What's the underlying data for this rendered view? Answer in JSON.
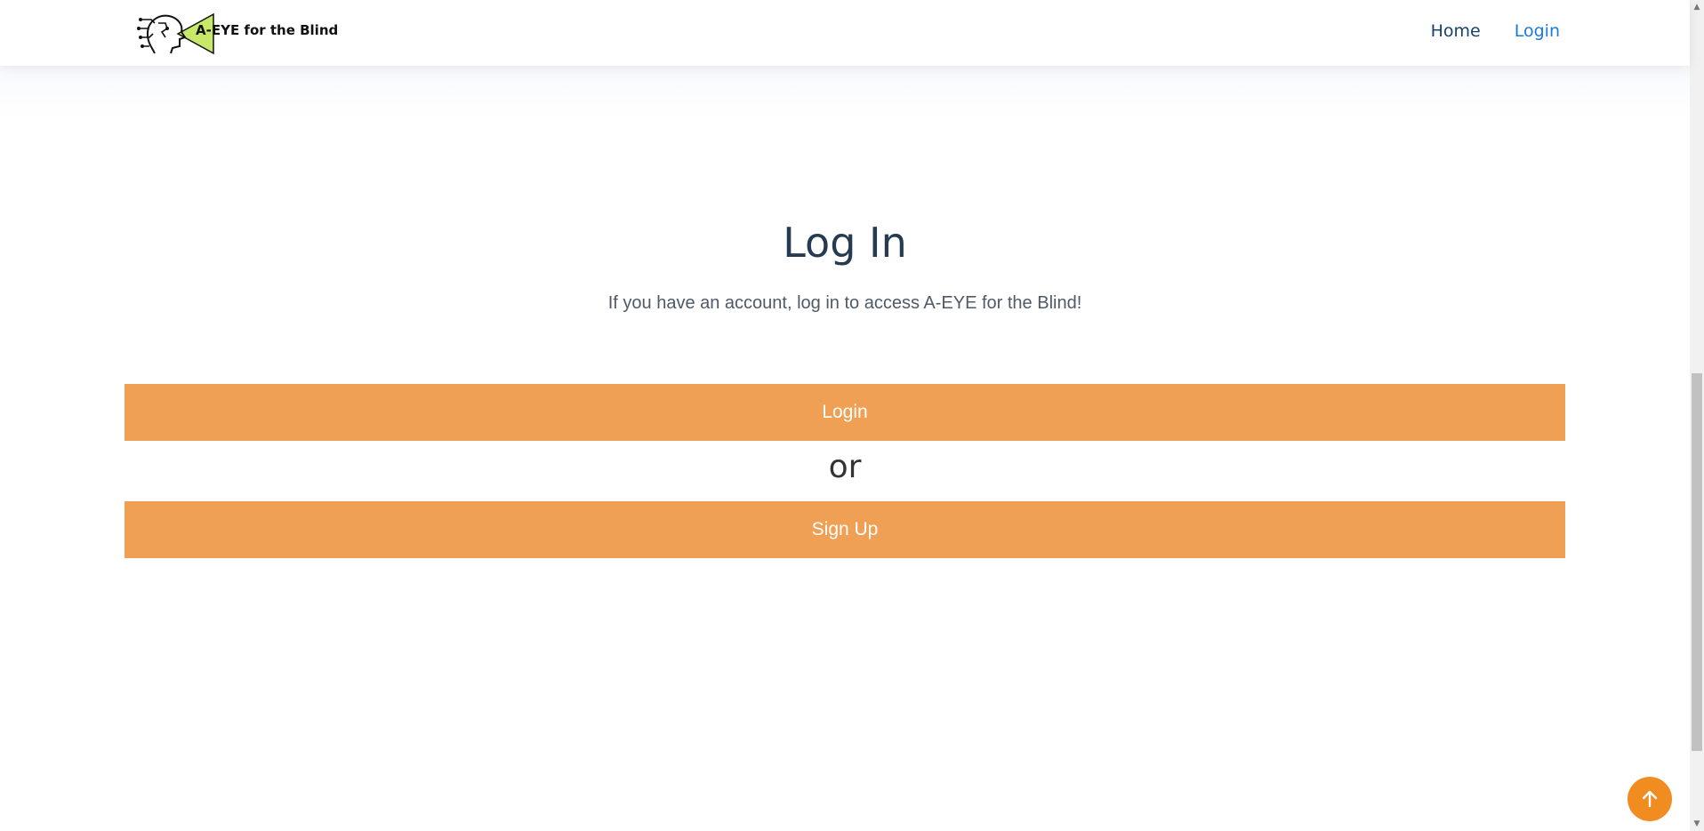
{
  "header": {
    "logo_text": "A-EYE for the Blind",
    "nav": {
      "home": "Home",
      "login": "Login"
    }
  },
  "main": {
    "title": "Log In",
    "subtitle": "If you have an account, log in to access A-EYE for the Blind!",
    "login_button": "Login",
    "separator": "or",
    "signup_button": "Sign Up"
  },
  "colors": {
    "accent": "#f0a054",
    "back_to_top": "#f08c20",
    "title": "#263a52",
    "nav_active": "#1a7ad9",
    "logo_green": "#c8e86a"
  },
  "icons": {
    "logo": "robot-head-eye-icon",
    "back_to_top": "arrow-up-icon"
  }
}
